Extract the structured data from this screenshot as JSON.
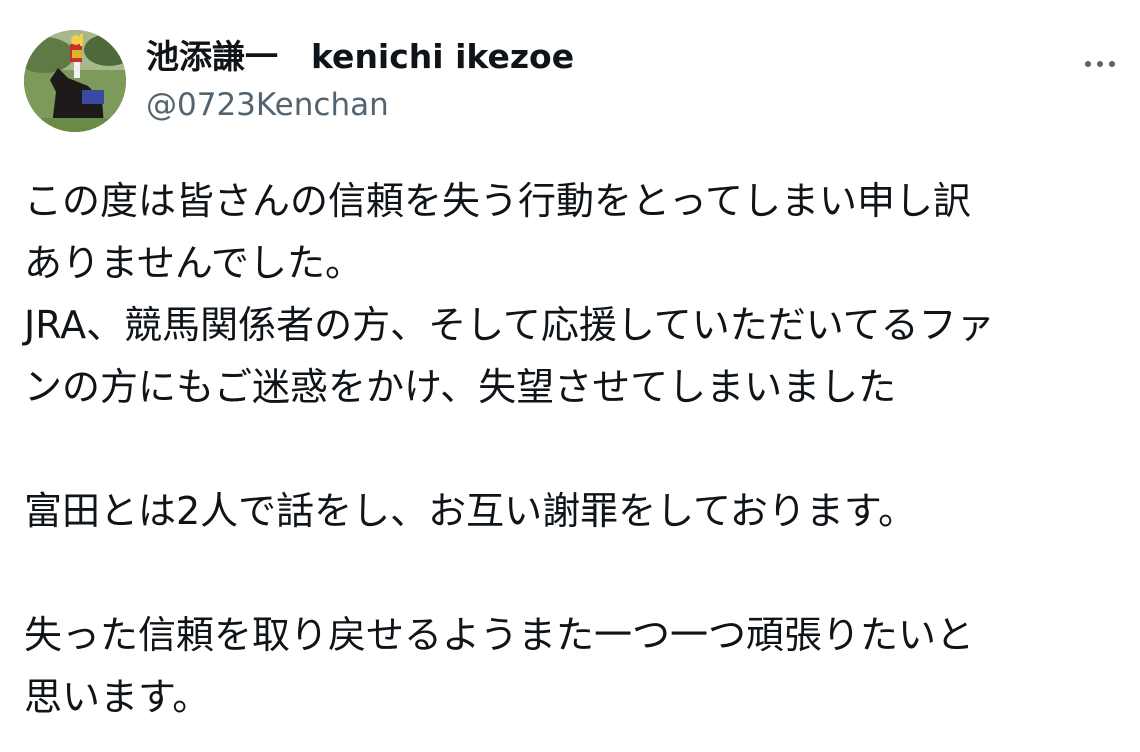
{
  "tweet": {
    "author": {
      "display_name": "池添謙一　kenichi ikezoe",
      "handle": "@0723Kenchan",
      "avatar": "jockey-on-horse-photo"
    },
    "more_icon": "more-horizontal-icon",
    "lines": [
      "この度は皆さんの信頼を失う行動をとってしまい申し訳",
      "ありませんでした。",
      "JRA、競馬関係者の方、そして応援していただいてるファ",
      "ンの方にもご迷惑をかけ、失望させてしまいました",
      "",
      "富田とは2人で話をし、お互い謝罪をしております。",
      "",
      "失った信頼を取り戻せるようまた一つ一つ頑張りたいと",
      "思います。"
    ]
  },
  "colors": {
    "text_primary": "#0f1419",
    "text_secondary": "#536471",
    "background": "#ffffff"
  }
}
